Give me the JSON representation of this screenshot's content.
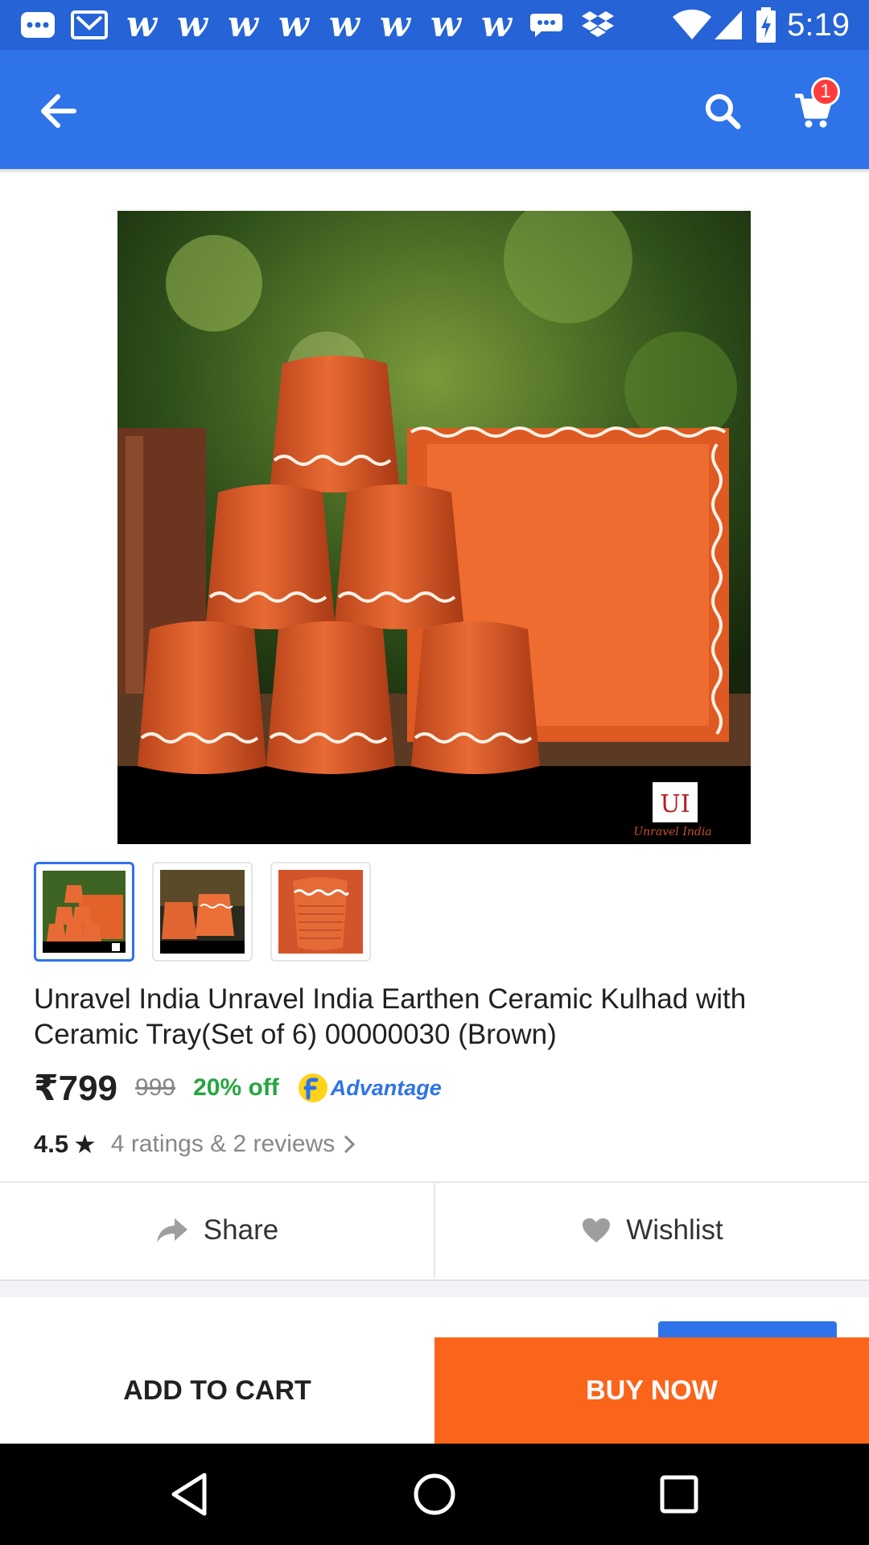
{
  "status_bar": {
    "time": "5:19",
    "notification_icons": [
      "messages-icon",
      "gmail-icon",
      "w-app-icon",
      "w-app-icon",
      "w-app-icon",
      "w-app-icon",
      "w-app-icon",
      "w-app-icon",
      "w-app-icon",
      "w-app-icon",
      "chat-icon",
      "dropbox-icon"
    ],
    "w_glyph": "w",
    "system_icons": [
      "wifi-icon",
      "cellular-icon",
      "battery-charging-icon"
    ]
  },
  "app_bar": {
    "back_icon": "arrow-left-icon",
    "search_icon": "search-icon",
    "cart_icon": "cart-icon",
    "cart_count": "1"
  },
  "product": {
    "image_logo_text": "UI",
    "image_brand_text": "Unravel India",
    "thumbnails_count": 3,
    "selected_thumbnail": 1,
    "title": "Unravel India Unravel India Earthen Ceramic Kulhad with Ceramic Tray(Set of 6) 00000030 (Brown)",
    "price": "₹799",
    "mrp": "999",
    "discount": "20% off",
    "advantage_label": "Advantage",
    "rating": "4.5",
    "rating_star": "★",
    "reviews_text": "4 ratings & 2 reviews"
  },
  "actions": {
    "share_label": "Share",
    "wishlist_label": "Wishlist"
  },
  "bottom_bar": {
    "add_to_cart": "ADD TO CART",
    "buy_now": "BUY NOW"
  },
  "colors": {
    "status_bar": "#2563d6",
    "app_bar": "#2f73e8",
    "buy_now": "#fb641b",
    "discount": "#26a541",
    "badge": "#ff3b3b"
  }
}
